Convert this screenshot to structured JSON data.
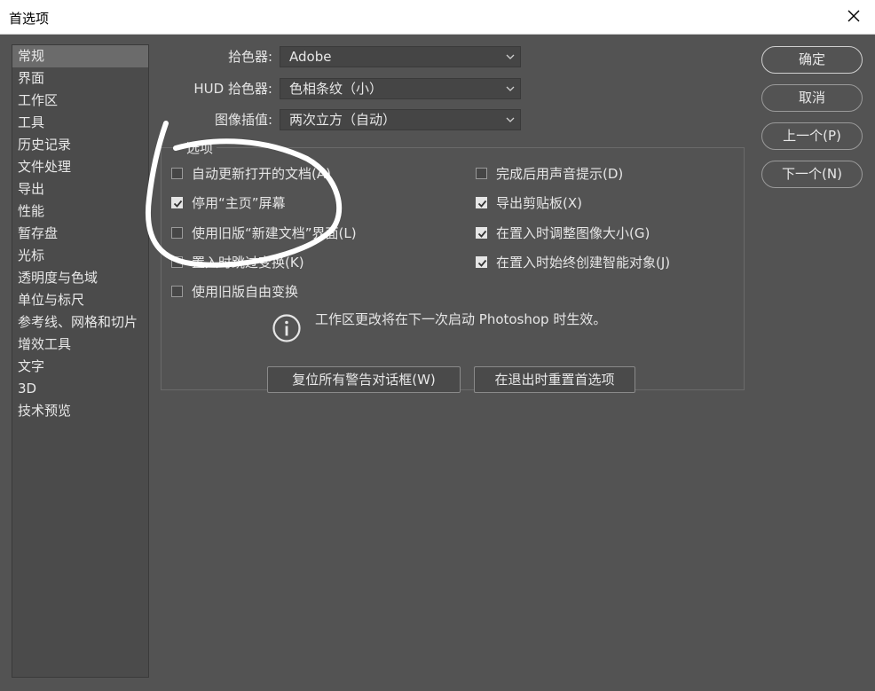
{
  "window": {
    "title": "首选项"
  },
  "sidebar": {
    "items": [
      {
        "label": "常规",
        "active": true
      },
      {
        "label": "界面"
      },
      {
        "label": "工作区"
      },
      {
        "label": "工具"
      },
      {
        "label": "历史记录"
      },
      {
        "label": "文件处理"
      },
      {
        "label": "导出"
      },
      {
        "label": "性能"
      },
      {
        "label": "暂存盘"
      },
      {
        "label": "光标"
      },
      {
        "label": "透明度与色域"
      },
      {
        "label": "单位与标尺"
      },
      {
        "label": "参考线、网格和切片"
      },
      {
        "label": "增效工具"
      },
      {
        "label": "文字"
      },
      {
        "label": "3D"
      },
      {
        "label": "技术预览"
      }
    ]
  },
  "fields": {
    "color_picker": {
      "label": "拾色器:",
      "value": "Adobe"
    },
    "hud_picker": {
      "label": "HUD 拾色器:",
      "value": "色相条纹（小）"
    },
    "interpolation": {
      "label": "图像插值:",
      "value": "两次立方（自动）"
    }
  },
  "options": {
    "legend": "选项",
    "left": [
      {
        "label": "自动更新打开的文档(A)",
        "checked": false
      },
      {
        "label": "停用“主页”屏幕",
        "checked": true
      },
      {
        "label": "使用旧版“新建文档”界面(L)",
        "checked": false
      },
      {
        "label": "置入时跳过变换(K)",
        "checked": false
      },
      {
        "label": "使用旧版自由变换",
        "checked": false
      }
    ],
    "right": [
      {
        "label": "完成后用声音提示(D)",
        "checked": false
      },
      {
        "label": "导出剪贴板(X)",
        "checked": true
      },
      {
        "label": "在置入时调整图像大小(G)",
        "checked": true
      },
      {
        "label": "在置入时始终创建智能对象(J)",
        "checked": true
      }
    ],
    "info_text": "工作区更改将在下一次启动 Photoshop 时生效。"
  },
  "actions": {
    "reset_warnings": "复位所有警告对话框(W)",
    "reset_on_quit": "在退出时重置首选项"
  },
  "buttons": {
    "ok": "确定",
    "cancel": "取消",
    "prev": "上一个(P)",
    "next": "下一个(N)"
  },
  "colors": {
    "panel_bg": "#535353",
    "sidebar_bg": "#4b4b4b",
    "selected": "#6b6b6b",
    "text": "#e6e6e6"
  }
}
